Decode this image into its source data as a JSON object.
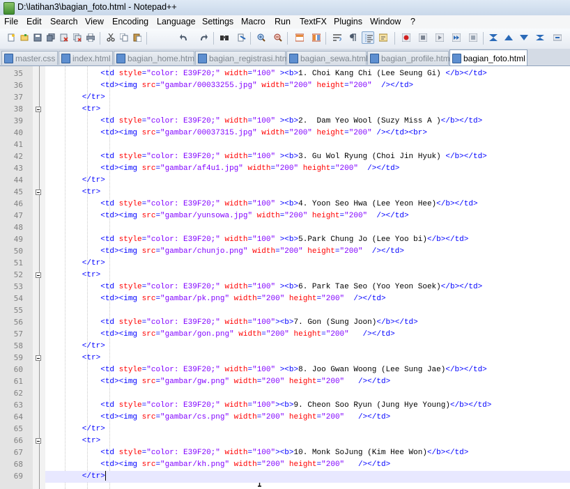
{
  "window": {
    "title": "D:\\latihan3\\bagian_foto.html - Notepad++",
    "icon": "notepad-plus-plus-icon"
  },
  "menu": [
    "File",
    "Edit",
    "Search",
    "View",
    "Encoding",
    "Language",
    "Settings",
    "Macro",
    "Run",
    "TextFX",
    "Plugins",
    "Window",
    "?"
  ],
  "toolbar": {
    "buttons": [
      "new-file-icon",
      "open-file-icon",
      "save-icon",
      "save-all-icon",
      "close-icon",
      "close-all-icon",
      "print-icon",
      "cut-icon",
      "copy-icon",
      "paste-icon",
      "undo-icon",
      "redo-icon",
      "find-icon",
      "replace-icon",
      "zoom-in-icon",
      "zoom-out-icon",
      "sync-vertical-icon",
      "sync-horizontal-icon",
      "word-wrap-icon",
      "show-all-chars-icon",
      "indent-guide-icon",
      "user-language-icon",
      "record-macro-icon",
      "stop-record-icon",
      "play-macro-icon",
      "play-multiple-icon",
      "save-macro-icon",
      "mark-icon",
      "prev-icon",
      "next-icon",
      "bookmark-icon",
      "run-icon"
    ]
  },
  "tabs": [
    {
      "label": "master.css",
      "active": false
    },
    {
      "label": "index.html",
      "active": false
    },
    {
      "label": "bagian_home.html",
      "active": false
    },
    {
      "label": "bagian_registrasi.html",
      "active": false
    },
    {
      "label": "bagian_sewa.html",
      "active": false
    },
    {
      "label": "bagian_profile.html",
      "active": false
    },
    {
      "label": "bagian_foto.html",
      "active": true
    }
  ],
  "colors": {
    "tag": "#0000ff",
    "attribute": "#ff0000",
    "value": "#8000ff",
    "text": "#000000",
    "current_line": "#e8e8ff"
  },
  "editor": {
    "current_line": 69,
    "lines": [
      {
        "n": 35,
        "fold": false,
        "code": [
          [
            "t",
            "            <td "
          ],
          [
            "a",
            "style"
          ],
          [
            "t",
            "="
          ],
          [
            "v",
            "\"color: E39F20;\""
          ],
          [
            "a",
            " width"
          ],
          [
            "t",
            "="
          ],
          [
            "v",
            "\"100\""
          ],
          [
            "t",
            " ><b>"
          ],
          [
            "x",
            "1. Choi Kang Chi (Lee Seung Gi) "
          ],
          [
            "t",
            "</b></td>"
          ]
        ]
      },
      {
        "n": 36,
        "fold": false,
        "code": [
          [
            "t",
            "            <td><img "
          ],
          [
            "a",
            "src"
          ],
          [
            "t",
            "="
          ],
          [
            "v",
            "\"gambar/00033255.jpg\""
          ],
          [
            "a",
            " width"
          ],
          [
            "t",
            "="
          ],
          [
            "v",
            "\"200\""
          ],
          [
            "a",
            " height"
          ],
          [
            "t",
            "="
          ],
          [
            "v",
            "\"200\""
          ],
          [
            "t",
            "  /></td>"
          ]
        ]
      },
      {
        "n": 37,
        "fold": false,
        "code": [
          [
            "t",
            "        </tr>"
          ]
        ]
      },
      {
        "n": 38,
        "fold": true,
        "code": [
          [
            "t",
            "        <tr>"
          ]
        ]
      },
      {
        "n": 39,
        "fold": false,
        "code": [
          [
            "t",
            "            <td "
          ],
          [
            "a",
            "style"
          ],
          [
            "t",
            "="
          ],
          [
            "v",
            "\"color: E39F20;\""
          ],
          [
            "a",
            " width"
          ],
          [
            "t",
            "="
          ],
          [
            "v",
            "\"100\""
          ],
          [
            "t",
            " ><b>"
          ],
          [
            "x",
            "2.  Dam Yeo Wool (Suzy Miss A )"
          ],
          [
            "t",
            "</b></td>"
          ]
        ]
      },
      {
        "n": 40,
        "fold": false,
        "code": [
          [
            "t",
            "            <td><img "
          ],
          [
            "a",
            "src"
          ],
          [
            "t",
            "="
          ],
          [
            "v",
            "\"gambar/00037315.jpg\""
          ],
          [
            "a",
            " width"
          ],
          [
            "t",
            "="
          ],
          [
            "v",
            "\"200\""
          ],
          [
            "a",
            " height"
          ],
          [
            "t",
            "="
          ],
          [
            "v",
            "\"200\""
          ],
          [
            "t",
            " /></td><br>"
          ]
        ]
      },
      {
        "n": 41,
        "fold": false,
        "code": []
      },
      {
        "n": 42,
        "fold": false,
        "code": [
          [
            "t",
            "            <td "
          ],
          [
            "a",
            "style"
          ],
          [
            "t",
            "="
          ],
          [
            "v",
            "\"color: E39F20;\""
          ],
          [
            "a",
            " width"
          ],
          [
            "t",
            "="
          ],
          [
            "v",
            "\"100\""
          ],
          [
            "t",
            " ><b>"
          ],
          [
            "x",
            "3. Gu Wol Ryung (Choi Jin Hyuk) "
          ],
          [
            "t",
            "</b></td>"
          ]
        ]
      },
      {
        "n": 43,
        "fold": false,
        "code": [
          [
            "t",
            "            <td><img "
          ],
          [
            "a",
            "src"
          ],
          [
            "t",
            "="
          ],
          [
            "v",
            "\"gambar/af4u1.jpg\""
          ],
          [
            "a",
            " width"
          ],
          [
            "t",
            "="
          ],
          [
            "v",
            "\"200\""
          ],
          [
            "a",
            " height"
          ],
          [
            "t",
            "="
          ],
          [
            "v",
            "\"200\""
          ],
          [
            "t",
            "  /></td>"
          ]
        ]
      },
      {
        "n": 44,
        "fold": false,
        "code": [
          [
            "t",
            "        </tr>"
          ]
        ]
      },
      {
        "n": 45,
        "fold": true,
        "code": [
          [
            "t",
            "        <tr>"
          ]
        ]
      },
      {
        "n": 46,
        "fold": false,
        "code": [
          [
            "t",
            "            <td "
          ],
          [
            "a",
            "style"
          ],
          [
            "t",
            "="
          ],
          [
            "v",
            "\"color: E39F20;\""
          ],
          [
            "a",
            " width"
          ],
          [
            "t",
            "="
          ],
          [
            "v",
            "\"100\""
          ],
          [
            "t",
            " ><b>"
          ],
          [
            "x",
            "4. Yoon Seo Hwa (Lee Yeon Hee)"
          ],
          [
            "t",
            "</b></td>"
          ]
        ]
      },
      {
        "n": 47,
        "fold": false,
        "code": [
          [
            "t",
            "            <td><img "
          ],
          [
            "a",
            "src"
          ],
          [
            "t",
            "="
          ],
          [
            "v",
            "\"gambar/yunsowa.jpg\""
          ],
          [
            "a",
            " width"
          ],
          [
            "t",
            "="
          ],
          [
            "v",
            "\"200\""
          ],
          [
            "a",
            " height"
          ],
          [
            "t",
            "="
          ],
          [
            "v",
            "\"200\""
          ],
          [
            "t",
            "  /></td>"
          ]
        ]
      },
      {
        "n": 48,
        "fold": false,
        "code": []
      },
      {
        "n": 49,
        "fold": false,
        "code": [
          [
            "t",
            "            <td "
          ],
          [
            "a",
            "style"
          ],
          [
            "t",
            "="
          ],
          [
            "v",
            "\"color: E39F20;\""
          ],
          [
            "a",
            " width"
          ],
          [
            "t",
            "="
          ],
          [
            "v",
            "\"100\""
          ],
          [
            "t",
            " ><b>"
          ],
          [
            "x",
            "5.Park Chung Jo (Lee Yoo bi)"
          ],
          [
            "t",
            "</b></td>"
          ]
        ]
      },
      {
        "n": 50,
        "fold": false,
        "code": [
          [
            "t",
            "            <td><img "
          ],
          [
            "a",
            "src"
          ],
          [
            "t",
            "="
          ],
          [
            "v",
            "\"gambar/chunjo.png\""
          ],
          [
            "a",
            " width"
          ],
          [
            "t",
            "="
          ],
          [
            "v",
            "\"200\""
          ],
          [
            "a",
            " height"
          ],
          [
            "t",
            "="
          ],
          [
            "v",
            "\"200\""
          ],
          [
            "t",
            "  /></td>"
          ]
        ]
      },
      {
        "n": 51,
        "fold": false,
        "code": [
          [
            "t",
            "        </tr>"
          ]
        ]
      },
      {
        "n": 52,
        "fold": true,
        "code": [
          [
            "t",
            "        <tr>"
          ]
        ]
      },
      {
        "n": 53,
        "fold": false,
        "code": [
          [
            "t",
            "            <td "
          ],
          [
            "a",
            "style"
          ],
          [
            "t",
            "="
          ],
          [
            "v",
            "\"color: E39F20;\""
          ],
          [
            "a",
            " width"
          ],
          [
            "t",
            "="
          ],
          [
            "v",
            "\"100\""
          ],
          [
            "t",
            " ><b>"
          ],
          [
            "x",
            "6. Park Tae Seo (Yoo Yeon Soek)"
          ],
          [
            "t",
            "</b></td>"
          ]
        ]
      },
      {
        "n": 54,
        "fold": false,
        "code": [
          [
            "t",
            "            <td><img "
          ],
          [
            "a",
            "src"
          ],
          [
            "t",
            "="
          ],
          [
            "v",
            "\"gambar/pk.png\""
          ],
          [
            "a",
            " width"
          ],
          [
            "t",
            "="
          ],
          [
            "v",
            "\"200\""
          ],
          [
            "a",
            " height"
          ],
          [
            "t",
            "="
          ],
          [
            "v",
            "\"200\""
          ],
          [
            "t",
            "  /></td>"
          ]
        ]
      },
      {
        "n": 55,
        "fold": false,
        "code": []
      },
      {
        "n": 56,
        "fold": false,
        "code": [
          [
            "t",
            "            <td "
          ],
          [
            "a",
            "style"
          ],
          [
            "t",
            "="
          ],
          [
            "v",
            "\"color: E39F20;\""
          ],
          [
            "a",
            " width"
          ],
          [
            "t",
            "="
          ],
          [
            "v",
            "\"100\""
          ],
          [
            "t",
            "><b>"
          ],
          [
            "x",
            "7. Gon (Sung Joon)"
          ],
          [
            "t",
            "</b></td>"
          ]
        ]
      },
      {
        "n": 57,
        "fold": false,
        "code": [
          [
            "t",
            "            <td><img "
          ],
          [
            "a",
            "src"
          ],
          [
            "t",
            "="
          ],
          [
            "v",
            "\"gambar/gon.png\""
          ],
          [
            "a",
            " width"
          ],
          [
            "t",
            "="
          ],
          [
            "v",
            "\"200\""
          ],
          [
            "a",
            " height"
          ],
          [
            "t",
            "="
          ],
          [
            "v",
            "\"200\""
          ],
          [
            "t",
            "   /></td>"
          ]
        ]
      },
      {
        "n": 58,
        "fold": false,
        "code": [
          [
            "t",
            "        </tr>"
          ]
        ]
      },
      {
        "n": 59,
        "fold": true,
        "code": [
          [
            "t",
            "        <tr>"
          ]
        ]
      },
      {
        "n": 60,
        "fold": false,
        "code": [
          [
            "t",
            "            <td "
          ],
          [
            "a",
            "style"
          ],
          [
            "t",
            "="
          ],
          [
            "v",
            "\"color: E39F20;\""
          ],
          [
            "a",
            " width"
          ],
          [
            "t",
            "="
          ],
          [
            "v",
            "\"100\""
          ],
          [
            "t",
            " ><b>"
          ],
          [
            "x",
            "8. Joo Gwan Woong (Lee Sung Jae)"
          ],
          [
            "t",
            "</b></td>"
          ]
        ]
      },
      {
        "n": 61,
        "fold": false,
        "code": [
          [
            "t",
            "            <td><img "
          ],
          [
            "a",
            "src"
          ],
          [
            "t",
            "="
          ],
          [
            "v",
            "\"gambar/gw.png\""
          ],
          [
            "a",
            " width"
          ],
          [
            "t",
            "="
          ],
          [
            "v",
            "\"200\""
          ],
          [
            "a",
            " height"
          ],
          [
            "t",
            "="
          ],
          [
            "v",
            "\"200\""
          ],
          [
            "t",
            "   /></td>"
          ]
        ]
      },
      {
        "n": 62,
        "fold": false,
        "code": []
      },
      {
        "n": 63,
        "fold": false,
        "code": [
          [
            "t",
            "            <td "
          ],
          [
            "a",
            "style"
          ],
          [
            "t",
            "="
          ],
          [
            "v",
            "\"color: E39F20;\""
          ],
          [
            "a",
            " width"
          ],
          [
            "t",
            "="
          ],
          [
            "v",
            "\"100\""
          ],
          [
            "t",
            "><b>"
          ],
          [
            "x",
            "9. Cheon Soo Ryun (Jung Hye Young)"
          ],
          [
            "t",
            "</b></td>"
          ]
        ]
      },
      {
        "n": 64,
        "fold": false,
        "code": [
          [
            "t",
            "            <td><img "
          ],
          [
            "a",
            "src"
          ],
          [
            "t",
            "="
          ],
          [
            "v",
            "\"gambar/cs.png\""
          ],
          [
            "a",
            " width"
          ],
          [
            "t",
            "="
          ],
          [
            "v",
            "\"200\""
          ],
          [
            "a",
            " height"
          ],
          [
            "t",
            "="
          ],
          [
            "v",
            "\"200\""
          ],
          [
            "t",
            "   /></td>"
          ]
        ]
      },
      {
        "n": 65,
        "fold": false,
        "code": [
          [
            "t",
            "        </tr>"
          ]
        ]
      },
      {
        "n": 66,
        "fold": true,
        "code": [
          [
            "t",
            "        <tr>"
          ]
        ]
      },
      {
        "n": 67,
        "fold": false,
        "code": [
          [
            "t",
            "            <td "
          ],
          [
            "a",
            "style"
          ],
          [
            "t",
            "="
          ],
          [
            "v",
            "\"color: E39F20;\""
          ],
          [
            "a",
            " width"
          ],
          [
            "t",
            "="
          ],
          [
            "v",
            "\"100\""
          ],
          [
            "t",
            "><b>"
          ],
          [
            "x",
            "10. Monk SoJung (Kim Hee Won)"
          ],
          [
            "t",
            "</b></td>"
          ]
        ]
      },
      {
        "n": 68,
        "fold": false,
        "code": [
          [
            "t",
            "            <td><img "
          ],
          [
            "a",
            "src"
          ],
          [
            "t",
            "="
          ],
          [
            "v",
            "\"gambar/kh.png\""
          ],
          [
            "a",
            " width"
          ],
          [
            "t",
            "="
          ],
          [
            "v",
            "\"200\""
          ],
          [
            "a",
            " height"
          ],
          [
            "t",
            "="
          ],
          [
            "v",
            "\"200\""
          ],
          [
            "t",
            "   /></td>"
          ]
        ]
      },
      {
        "n": 69,
        "fold": false,
        "code": [
          [
            "t",
            "        </tr>"
          ]
        ]
      }
    ]
  }
}
